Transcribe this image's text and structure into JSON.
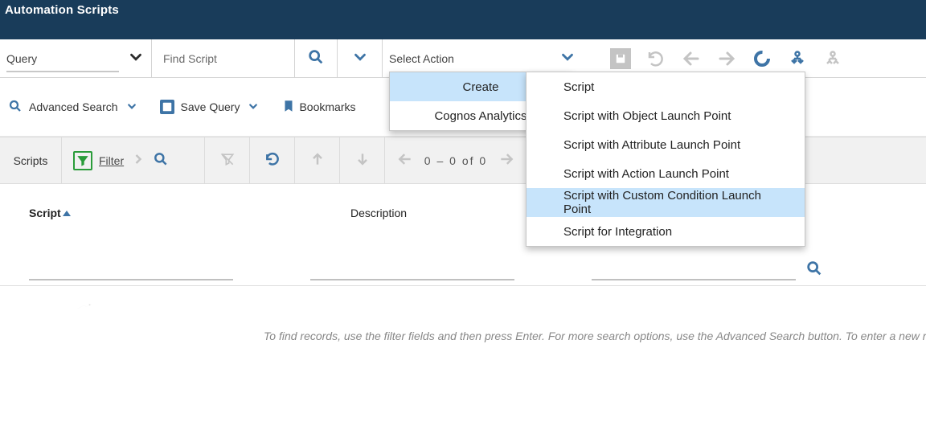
{
  "header": {
    "title": "Automation Scripts"
  },
  "toolbar": {
    "query_label": "Query",
    "find_placeholder": "Find Script",
    "select_action_label": "Select Action"
  },
  "secbar": {
    "advanced_search": "Advanced Search",
    "save_query": "Save Query",
    "bookmarks": "Bookmarks"
  },
  "listbar": {
    "scripts_label": "Scripts",
    "filter_label": "Filter",
    "paging_text": "0  –  0  of  0"
  },
  "columns": {
    "script": "Script",
    "description": "Description"
  },
  "empty": {
    "text": "To find records, use the filter fields and then press Enter. For more search options, use the Advanced Search button. To enter a new reco"
  },
  "action_menu": {
    "items": [
      {
        "label": "Create",
        "has_submenu": true,
        "hover": true
      },
      {
        "label": "Cognos Analytics",
        "has_submenu": false,
        "hover": false
      }
    ]
  },
  "create_submenu": {
    "items": [
      {
        "label": "Script",
        "hover": false
      },
      {
        "label": "Script with Object Launch Point",
        "hover": false
      },
      {
        "label": "Script with Attribute Launch Point",
        "hover": false
      },
      {
        "label": "Script with Action Launch Point",
        "hover": false
      },
      {
        "label": "Script with Custom Condition Launch Point",
        "hover": true
      },
      {
        "label": "Script for Integration",
        "hover": false
      }
    ]
  },
  "icons": {
    "search": "search-icon",
    "chevron_down": "chevron-down-icon",
    "save": "save-disk-icon",
    "undo": "undo-icon",
    "back": "arrow-left-icon",
    "forward": "arrow-right-icon",
    "donut": "loading-ring-icon",
    "route_down": "route-down-icon",
    "route_up": "route-up-icon",
    "funnel": "funnel-icon",
    "clear_funnel": "clear-funnel-icon",
    "refresh": "refresh-icon",
    "up": "arrow-up-icon",
    "down": "arrow-down-icon",
    "bookmark": "bookmark-icon",
    "chevron_right": "chevron-right-icon"
  }
}
